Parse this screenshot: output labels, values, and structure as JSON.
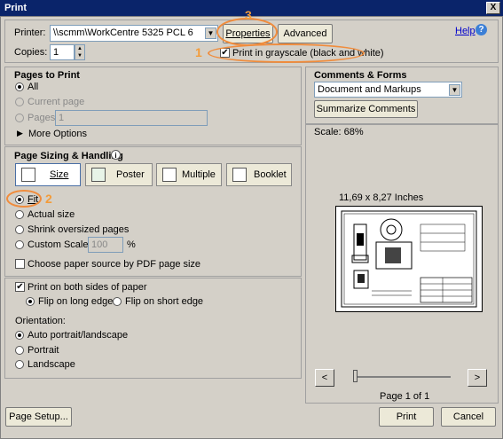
{
  "window": {
    "title": "Print",
    "close_glyph": "X"
  },
  "printer": {
    "label": "Printer:",
    "value": "\\\\scmm\\WorkCentre 5325 PCL 6",
    "properties_button": "Properties",
    "advanced_button": "Advanced",
    "help_link": "Help",
    "copies_label": "Copies:",
    "copies_value": "1",
    "grayscale_label": "Print in grayscale (black and white)"
  },
  "annotations": {
    "one": "1",
    "two": "2",
    "three": "3"
  },
  "pages_to_print": {
    "title": "Pages to Print",
    "all": "All",
    "current_page": "Current page",
    "pages": "Pages",
    "pages_value": "1",
    "more_options": "More Options"
  },
  "comments_forms": {
    "title": "Comments & Forms",
    "selected": "Document and Markups",
    "summarize_button": "Summarize Comments"
  },
  "preview": {
    "scale": "Scale:  68%",
    "paper_size": "11,69 x 8,27 Inches",
    "page_label": "Page 1 of 1",
    "prev": "<",
    "next": ">"
  },
  "sizing": {
    "title": "Page Sizing & Handling",
    "info_glyph": "i",
    "tabs": [
      "Size",
      "Poster",
      "Multiple",
      "Booklet"
    ],
    "fit": "Fit",
    "actual_size": "Actual size",
    "shrink": "Shrink oversized pages",
    "custom_scale": "Custom Scale:",
    "custom_value": "100",
    "percent": "%",
    "choose_paper": "Choose paper source by PDF page size"
  },
  "duplex": {
    "both_sides": "Print on both sides of paper",
    "long_edge": "Flip on long edge",
    "short_edge": "Flip on short edge"
  },
  "orientation": {
    "label": "Orientation:",
    "auto": "Auto portrait/landscape",
    "portrait": "Portrait",
    "landscape": "Landscape"
  },
  "footer": {
    "page_setup": "Page Setup...",
    "print": "Print",
    "cancel": "Cancel"
  },
  "colors": {
    "annotation": "#f08c3c",
    "titlebar": "#0a246a",
    "help": "#0000cc"
  }
}
